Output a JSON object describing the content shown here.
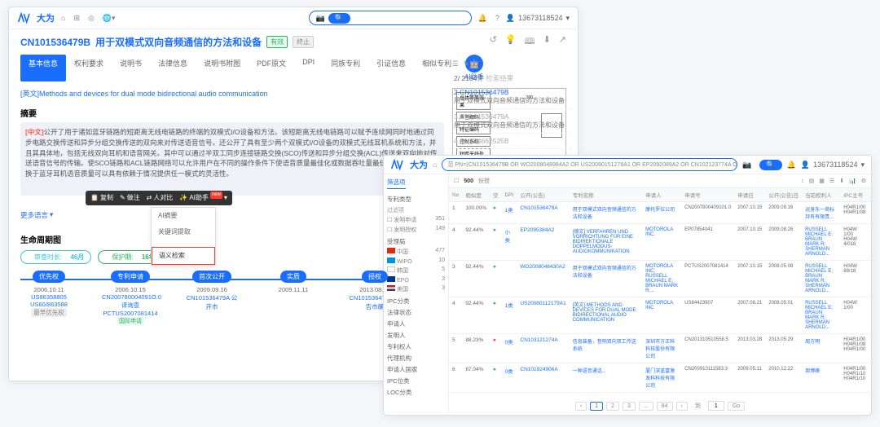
{
  "brand": "大为",
  "user_phone": "13673118524",
  "patent": {
    "number": "CN101536479B",
    "title_zh": "用于双模式双向音频通信的方法和设备",
    "badge1": "有效",
    "badge2": "终止",
    "title_en_prefix": "[英文]",
    "title_en": "Methods and devices for dual mode bidirectional audio communication",
    "abstract_head": "摘要",
    "abstract_tag": "[中文]",
    "abstract": "公开了用于诸如蓝牙链路的短距离无线电链路的终端的双模式I/O设备和方法。该短距离无线电链路可以赋予连续网同时地通过同步电路交换传送和异步分组交换传送的双向来对传送语音信号。还公开了具有至少两个双模式I/O设备的双模式无线耳机系统和方法，并且其具体地，包括无线双向耳机和语音网关。其中可以通过半双工同步连接链路交换(SCO)传送和异步分组交换(ACL)传送来双向地对传送语音信号的传输。使SCO链路和ACL链路网络可以允许用户在不同的操作条件下使语音质量最佳化或数据吞吐量最佳化。用户可以切换于蓝牙耳机语音质量可以具有依赖于情况提供任一模式的灵活性。",
    "more": "更多语言"
  },
  "tabs": [
    "基本信息",
    "权利要求",
    "说明书",
    "法律信息",
    "说明书附图",
    "PDF原文",
    "DPI",
    "同族专利",
    "引证信息",
    "相似专利"
  ],
  "ai_helper": "AI助手",
  "tooltip": {
    "copy": "复制",
    "note": "做注",
    "compare": "人对比",
    "ai": "AI助手"
  },
  "dropdown": [
    "AI摘要",
    "关键词提取",
    "",
    "语义检索"
  ],
  "diagram_labels": [
    "总体等等效果",
    "声音解码",
    "特征编码",
    "控制系统",
    "短距无线处理"
  ],
  "sidebar": {
    "count_prefix": "2/ 2184件",
    "count_suffix": "检索结果",
    "items": [
      {
        "num": "2.CN101536479B",
        "desc": "用于双模式双向音频通信的方法和设备"
      },
      {
        "num": "3.CN101536479A",
        "desc": "用于双模式双向音频通信的方法和设备"
      },
      {
        "num": "4.CN104662525B",
        "desc": ""
      }
    ]
  },
  "timeline": {
    "head": "生命周期图",
    "age_label": "审查时长:",
    "age_val": "46月",
    "protect_label": "保护期:",
    "protect_val": "16年",
    "nodes": [
      {
        "label": "优先权",
        "date": "2006.10.11",
        "sub1": "US86358805",
        "sub2": "US60/863588",
        "tag": "最早优先权"
      },
      {
        "label": "专利申请",
        "date": "2006.10.15",
        "sub1": "CN200780004091O.0 译询查",
        "sub2": "PCTUS2007081414",
        "tag": "国际申请"
      },
      {
        "label": "首次公开",
        "date": "2009.09.16",
        "sub1": "CN101536479A 公开市"
      },
      {
        "label": "实质",
        "date": "2009.11.11"
      },
      {
        "label": "授权",
        "date": "2013.08.21",
        "sub1": "CN101536479B 公告市确"
      }
    ]
  },
  "front": {
    "query": "范 PN=(CN101536479B OR WO2008048984A2 OR US20080151278A1 OR EP2092089A2 OR CN102123774A OR CN101924009A OR CN103116820A OR CN102337457",
    "count": "500",
    "count_suffix": "份授",
    "filter_head": "筛选项",
    "filter_cat": "专利类型",
    "filter_sub1": "过滤项",
    "f1": {
      "label": "发明申请",
      "n": "351"
    },
    "f2": {
      "label": "发明授权",
      "n": "149"
    },
    "filter_sub2": "受理局",
    "countries": [
      {
        "name": "中国",
        "n": "477"
      },
      {
        "name": "WIPO",
        "n": "10"
      },
      {
        "name": "韩国",
        "n": "5"
      },
      {
        "name": "EPO",
        "n": "3"
      },
      {
        "name": "美国",
        "n": "3"
      }
    ],
    "more_filters": [
      "IPC分类",
      "法律状态",
      "申请人",
      "发明人",
      "专利权人",
      "代理机构",
      "申请人国家",
      "IPC位类",
      "LOC分类"
    ],
    "headers": [
      "No",
      "相似度",
      "空",
      "DPI",
      "公开(公告)",
      "专利名称",
      "申请人",
      "申请号",
      "申请日",
      "公开(公告)日",
      "当前权利人",
      "IPC主号"
    ],
    "rows": [
      {
        "no": "1",
        "sim": "100.00%",
        "st": "●",
        "dpi": "1类",
        "pub": "CN101536479A",
        "title": "用于双模式双向音频通信的方法和设备",
        "app": "摩托罗拉公司",
        "appno": "CN2007800409101.0",
        "appdate": "2007.10.15",
        "pubdate": "2009.09.16",
        "owner": "运身东一商标持有有限责...",
        "ipc": "H04R1/00 H04R1/08"
      },
      {
        "no": "4",
        "sim": "92.44%",
        "st": "●",
        "dpi": "小类",
        "pub": "EP2095384A2",
        "title": "[德文] VERFAHREN UND VORRICHTUNG FÜR EINE BIDIREKTIONALE DOPPELMODUS-AUDIOKOMMUNIKATION",
        "app": "MOTOROLA INC.",
        "appno": "EP07854041",
        "appdate": "2007.10.15",
        "pubdate": "2009.08.26",
        "owner": "RUSSELL MICHAEL E; BRAUN MARK R; SHERMAN ARNOLD...",
        "ipc": "H04W 1/00 H04W 4/018"
      },
      {
        "no": "3",
        "sim": "92.44%",
        "st": "●",
        "dpi": "",
        "pub": "WO2008048430A2",
        "title": "用于双模式双向音频通信的方法和设备",
        "app": "MOTOROLA INC; RUSSELL MICHAEL E; BRAUN MARK R;...",
        "appno": "PCTUS2007081414",
        "appdate": "2007.10.15",
        "pubdate": "2008.05.08",
        "owner": "RUSSELL MICHAEL E; BRAUN MARK R; SHERMAN ARNOLD...",
        "ipc": "H04W 88/18"
      },
      {
        "no": "4",
        "sim": "92.44%",
        "st": "●",
        "dpi": "1类",
        "pub": "US20080112179A1",
        "title": "[英文]  METHODS AND DEVICES FOR DUAL MODE BIDIRECTIONAL AUDIO COMMUNICATION",
        "app": "MOTOROLA INC",
        "appno": "US84423907",
        "appdate": "2007.08.21",
        "pubdate": "2008.05.01",
        "owner": "RUSSELL MICHAEL E; BRAUN MARK R; SHERMAN ARNOLD...",
        "ipc": "H04W 1/00"
      },
      {
        "no": "5",
        "sim": "88.23%",
        "st": "●",
        "dpi": "0类",
        "pub": "CN103121274A",
        "title": "信息装备，音响双向双工传送系统",
        "app": "深圳市方正科科技股份有限公司",
        "appno": "CN201310510558.5",
        "appdate": "2013.03.28",
        "pubdate": "2013.05.29",
        "owner": "周方明",
        "ipc": "H04R1/00 H04R1/08 H04R1/00"
      },
      {
        "no": "6",
        "sim": "87.04%",
        "st": "●",
        "dpi": "0类",
        "pub": "CN101924906A",
        "title": "一种语音通话...",
        "app": "厦门深蓝富激发科科技有限公司",
        "appno": "CN200910111583.3",
        "appdate": "2009.05.11",
        "pubdate": "2010.12.22",
        "owner": "周博峰",
        "ipc": "H04R1/00 H04R1/10 H04R1/10"
      }
    ],
    "pager": {
      "pages": [
        "1",
        "2",
        "3",
        "...",
        "84"
      ],
      "jump_label": "到",
      "jump_btn": "Go"
    }
  }
}
